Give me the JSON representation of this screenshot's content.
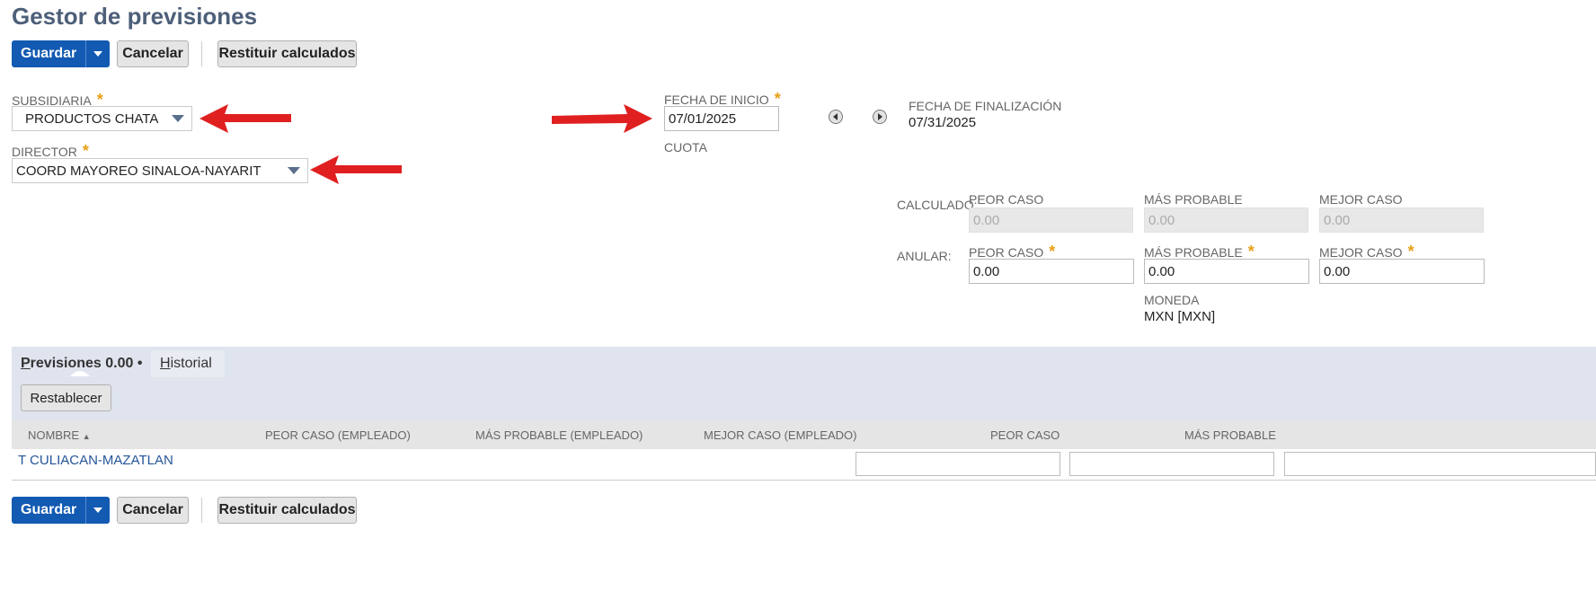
{
  "page": {
    "title": "Gestor de previsiones"
  },
  "toolbar": {
    "save_label": "Guardar",
    "cancel_label": "Cancelar",
    "reset_calc_label": "Restituir calculados"
  },
  "form": {
    "subsidiary": {
      "label": "SUBSIDIARIA",
      "value": "PRODUCTOS CHATA"
    },
    "director": {
      "label": "DIRECTOR",
      "value": "COORD MAYOREO SINALOA-NAYARIT"
    },
    "start_date": {
      "label": "FECHA DE INICIO",
      "value": "07/01/2025"
    },
    "end_date": {
      "label": "FECHA DE FINALIZACIÓN",
      "value": "07/31/2025"
    },
    "quota_label": "CUOTA",
    "calculated": {
      "label": "CALCULADO:",
      "worst_label": "PEOR CASO",
      "worst_value": "0.00",
      "likely_label": "MÁS PROBABLE",
      "likely_value": "0.00",
      "best_label": "MEJOR CASO",
      "best_value": "0.00"
    },
    "override": {
      "label": "ANULAR:",
      "worst_label": "PEOR CASO",
      "worst_value": "0.00",
      "likely_label": "MÁS PROBABLE",
      "likely_value": "0.00",
      "best_label": "MEJOR CASO",
      "best_value": "0.00"
    },
    "currency": {
      "label": "MONEDA",
      "value": "MXN [MXN]"
    },
    "required_mark": "*"
  },
  "tabs": {
    "forecasts": {
      "label_underlined": "P",
      "label_rest": "revisiones 0.00",
      "dot": "•"
    },
    "history": {
      "label_underlined": "H",
      "label_rest": "istorial"
    }
  },
  "sublist": {
    "reset_label": "Restablecer",
    "columns": {
      "name": "NOMBRE",
      "sort_indicator": "▲",
      "worst_emp": "PEOR CASO (EMPLEADO)",
      "likely_emp": "MÁS PROBABLE (EMPLEADO)",
      "best_emp": "MEJOR CASO (EMPLEADO)",
      "worst": "PEOR CASO",
      "likely": "MÁS PROBABLE"
    },
    "rows": [
      {
        "name": "T CULIACAN-MAZATLAN"
      }
    ]
  },
  "colors": {
    "primary": "#125ab2",
    "title": "#4d5f79",
    "link": "#255599",
    "arrow": "#e02020",
    "required": "#e8a017"
  }
}
